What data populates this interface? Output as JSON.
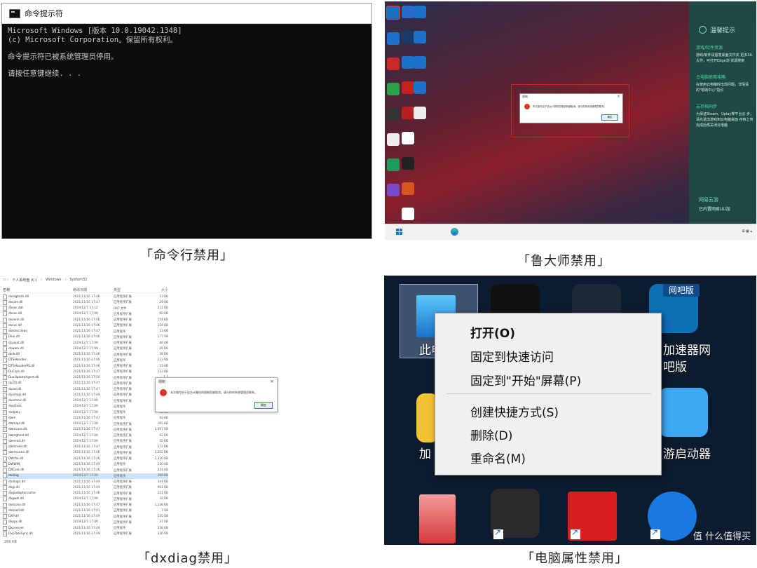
{
  "panel1": {
    "title": "命令提示符",
    "lines": [
      "Microsoft Windows [版本 10.0.19042.1348]",
      "(c) Microsoft Corporation。保留所有权利。",
      "",
      "命令提示符已被系统管理员停用。",
      "",
      "请按任意键继续. . ."
    ],
    "caption": "「命令行禁用」"
  },
  "panel2": {
    "side_title": "温馨提示",
    "sections": [
      {
        "head": "游戏/软件资源",
        "text": "游戏/软件请留意桌面文件夹 更多3A大作，可打开Edge浏 资源搜索"
      },
      {
        "head": "云电脑使用攻略",
        "text": "在使用云电脑时出现问题，详情请 的\"帮助中心\"指引"
      },
      {
        "head": "云存档同步",
        "text": "为保证Steam、Uplay等平台云 步，请先退出游戏到云电脑桌面 存档上传完成后再关闭云电脑"
      }
    ],
    "brand": "网易云游",
    "brand_sub": "已内置网易UU加",
    "dialog_title": "限制",
    "dialog_msg": "本次操作由于这台计算机的限制而被取消。请与你的系统管理员联系。",
    "dialog_ok": "确定",
    "caption": "「鲁大师禁用」"
  },
  "panel3": {
    "breadcrumb": [
      "个人系统盘 (C:)",
      "Windows",
      "System32"
    ],
    "headers": [
      "名称",
      "修改日期",
      "类型",
      "大小"
    ],
    "rows": [
      [
        "dxregback.dll",
        "2021/11/16 17:46",
        "应用程序扩展",
        "23 KB"
      ],
      [
        "dxcole.dll",
        "2021/11/16 17:47",
        "应用程序扩展",
        "29 KB"
      ],
      [
        "dxsec.dat",
        "2019/12/7 17:12",
        "DAT 文件",
        "211 KB"
      ],
      [
        "dxsec.dll",
        "2019/12/7 17:09",
        "应用程序扩展",
        "60 KB"
      ],
      [
        "dxsenh.dll",
        "2021/11/16 17:46",
        "应用程序扩展",
        "154 KB"
      ],
      [
        "dxsvc.dll",
        "2021/11/16 17:46",
        "应用程序扩展",
        "159 KB"
      ],
      [
        "dotdiscclean",
        "2021/11/16 17:47",
        "应用程序",
        "13 KB"
      ],
      [
        "Dsui.dll",
        "2021/11/16 17:46",
        "应用程序扩展",
        "177 KB"
      ],
      [
        "dsuiext.dll",
        "2019/12/7 17:09",
        "应用程序扩展",
        "86 KB"
      ],
      [
        "dsware.dll",
        "2019/12/7 17:09",
        "应用程序扩展",
        "26 KB"
      ],
      [
        "dtsh.dll",
        "2021/11/16 17:46",
        "应用程序扩展",
        "38 KB"
      ],
      [
        "DTSHandler",
        "2021/11/16 17:46",
        "应用程序",
        "123 KB"
      ],
      [
        "DTSHandlerPS.dll",
        "2021/11/16 17:46",
        "应用程序扩展",
        "23 KB"
      ],
      [
        "DuCsps.dll",
        "2021/11/16 17:47",
        "应用程序扩展",
        "113 KB"
      ],
      [
        "DuxUpdateAgent.dll",
        "2021/11/16 17:50",
        "应用程序扩展",
        "1,1"
      ],
      [
        "dui70.dll",
        "2021/11/16 17:47",
        "应用程序扩展",
        "1,"
      ],
      [
        "duser.dll",
        "2021/11/16 17:47",
        "应用程序扩展",
        ""
      ],
      [
        "dusmapi.dll",
        "2021/11/16 17:49",
        "应用程序扩展",
        ""
      ],
      [
        "dusmsvc.dll",
        "2019/12/7 17:09",
        "应用程序扩展",
        ""
      ],
      [
        "dvertask",
        "2019/12/7 17:09",
        "应用程序",
        ""
      ],
      [
        "dvdplay",
        "2019/12/7 17:09",
        "应用程序",
        "12 KB"
      ],
      [
        "dwm",
        "2021/11/16 17:47",
        "应用程序",
        "93 KB"
      ],
      [
        "dwmapi.dll",
        "2019/12/7 17:09",
        "应用程序扩展",
        "165 KB"
      ],
      [
        "dwmcore.dll",
        "2021/11/16 17:47",
        "应用程序扩展",
        "3,497 KB"
      ],
      [
        "dwmghost.dll",
        "2019/12/7 17:09",
        "应用程序扩展",
        "93 KB"
      ],
      [
        "dwminit.dll",
        "2019/12/7 17:09",
        "应用程序扩展",
        "50 KB"
      ],
      [
        "dwmredir.dll",
        "2021/11/16 17:47",
        "应用程序扩展",
        "172 KB"
      ],
      [
        "dwmscene.dll",
        "2021/11/16 17:46",
        "应用程序扩展",
        "2,202 KB"
      ],
      [
        "DWrite.dll",
        "2021/11/16 17:46",
        "应用程序扩展",
        "2,326 KB"
      ],
      [
        "DWWIN",
        "2021/11/16 17:49",
        "应用程序",
        "230 KB"
      ],
      [
        "DXCore.dll",
        "2021/11/16 17:46",
        "应用程序扩展",
        "214 KB"
      ],
      [
        "dxdiag",
        "2019/12/7 17:09",
        "应用程序",
        "266 KB"
      ],
      [
        "dxdiagn.dll",
        "2021/11/16 17:49",
        "应用程序扩展",
        "344 KB"
      ],
      [
        "dxgi.dll",
        "2021/11/16 17:49",
        "应用程序扩展",
        "961 KB"
      ],
      [
        "dxgiadaptercache",
        "2021/11/16 17:46",
        "应用程序扩展",
        "221 KB"
      ],
      [
        "dxgwdi.dll",
        "2019/12/7 17:09",
        "应用程序扩展",
        "32 KB"
      ],
      [
        "dxilconv.dll",
        "2021/11/16 17:47",
        "应用程序扩展",
        "1,238 KB"
      ],
      [
        "dxmasf.dll",
        "2021/11/16 17:51",
        "应用程序扩展",
        "7 KB"
      ],
      [
        "DXP.dll",
        "2021/11/16 17:49",
        "应用程序扩展",
        "535 KB"
      ],
      [
        "dxpps.dll",
        "2019/12/7 17:09",
        "应用程序扩展",
        "37 KB"
      ],
      [
        "Dxpserver",
        "2021/11/16 17:49",
        "应用程序",
        "328 KB"
      ],
      [
        "DxpTaskSync.dll",
        "2021/11/16 17:49",
        "应用程序扩展",
        "326 KB"
      ]
    ],
    "selected_row": 31,
    "status": "266 KB",
    "dialog_title": "限制",
    "dialog_msg": "本次操作由于这台计算机的限制而被取消。请与你的系统管理员联系。",
    "dialog_ok": "确定",
    "caption": "「dxdiag禁用」"
  },
  "panel4": {
    "menu_items": [
      "打开(O)",
      "固定到快速访问",
      "固定到\"开始\"屏幕(P)",
      "创建快捷方式(S)",
      "删除(D)",
      "重命名(M)"
    ],
    "desktop_labels": [
      "此电",
      "加速器网",
      "吧版",
      "加",
      "游启动器"
    ],
    "badge": "网吧版",
    "watermark": "值 什么值得买",
    "caption": "「电脑属性禁用」"
  }
}
